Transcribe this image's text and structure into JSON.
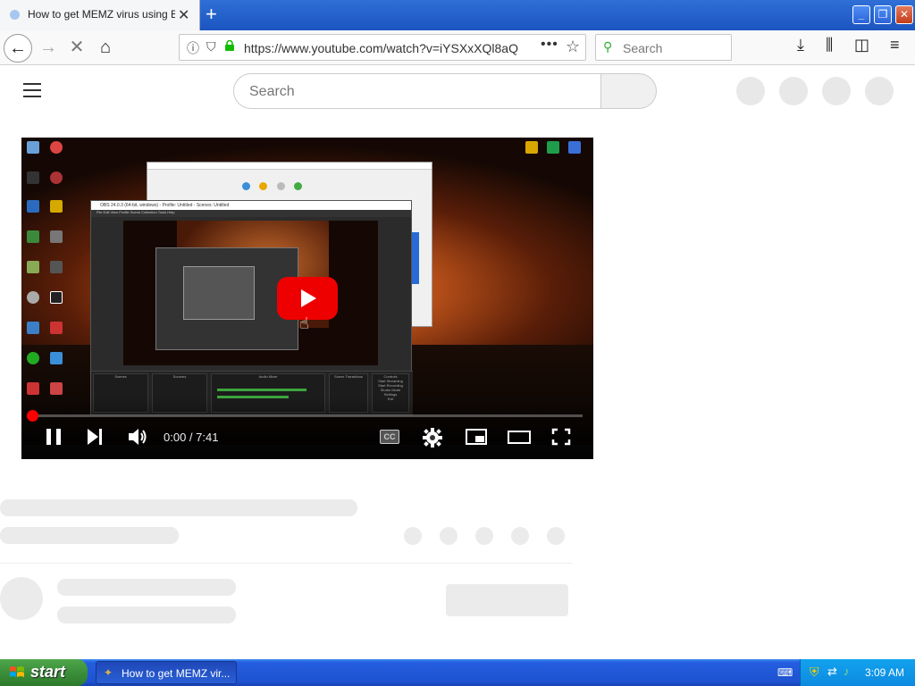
{
  "browser": {
    "tab_title": "How to get MEMZ virus using Batc",
    "tab_close": "✕",
    "new_tab": "+",
    "url": "https://www.youtube.com/watch?v=iYSXxXQl8aQ",
    "page_actions": "•••",
    "search_placeholder": "Search",
    "window_buttons": [
      "_",
      "❐",
      "✕"
    ]
  },
  "youtube": {
    "search_placeholder": "Search",
    "player": {
      "time": "0:00 / 7:41",
      "progress_fraction": 0.0,
      "cc_label": "CC",
      "obs_title": "OBS 24.0.3 (64-bit, windows) - Profile: Untitled - Scenes: Untitled",
      "obs_menu": "File  Edit  View  Profile  Scene Collection  Tools  Help",
      "dock_columns": [
        "Scenes",
        "Sources",
        "Audio Mixer",
        "Scene Transitions",
        "Controls"
      ],
      "controls_items": [
        "Start Streaming",
        "Start Recording",
        "Studio Mode",
        "Settings",
        "Exit"
      ]
    }
  },
  "taskbar": {
    "start_label": "start",
    "task_item": "How to get MEMZ vir...",
    "clock": "3:09 AM"
  },
  "colors": {
    "youtube_red": "#ff0000",
    "xp_blue": "#245ee0",
    "xp_green": "#3c8f3a"
  }
}
